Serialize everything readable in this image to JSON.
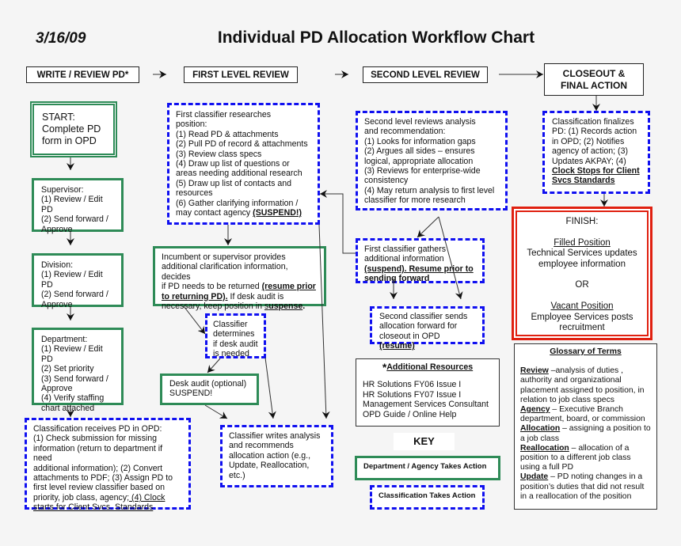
{
  "date": "3/16/09",
  "title": "Individual PD Allocation Workflow Chart",
  "headers": {
    "write": "WRITE / REVIEW PD*",
    "first": "FIRST LEVEL REVIEW",
    "second": "SECOND LEVEL REVIEW",
    "closeout": [
      "CLOSEOUT &",
      "FINAL ACTION"
    ]
  },
  "boxes": {
    "start": {
      "lines": [
        "START:",
        "Complete PD",
        "form in OPD"
      ]
    },
    "supervisor": {
      "lines": [
        "Supervisor:",
        "(1) Review / Edit PD",
        "(2) Send forward /",
        "Approve"
      ]
    },
    "division": {
      "lines": [
        "Division:",
        "(1) Review / Edit PD",
        "(2) Send forward /",
        "Approve"
      ]
    },
    "department": {
      "lines": [
        "Department:",
        "(1) Review / Edit PD",
        "(2) Set priority",
        "(3) Send forward /",
        "Approve",
        "(4) Verify staffing",
        "chart attached"
      ]
    },
    "receives": {
      "lines": [
        "Classification receives PD in OPD:",
        "(1) Check submission for missing",
        "information (return to department if need",
        "additional information); (2) Convert",
        "attachments to PDF; (3) Assign PD to",
        "first level review classifier based on",
        [
          [
            "priority, job class, agency",
            ""
          ],
          [
            "; (4) Clock",
            "u"
          ]
        ],
        [
          [
            "starts for Client Svcs. Standards",
            "u"
          ]
        ]
      ]
    },
    "researches": {
      "lines": [
        "First classifier researches",
        "position:",
        "(1) Read PD & attachments",
        "(2) Pull PD of record & attachments",
        "(3) Review class specs",
        "(4) Draw up list of questions or",
        "areas needing additional research",
        "(5) Draw up list of contacts and",
        "resources",
        "(6) Gather clarifying information /",
        [
          [
            "may contact agency ",
            ""
          ],
          [
            "(SUSPEND!)",
            "bu"
          ]
        ]
      ]
    },
    "incumbent": {
      "lines": [
        "Incumbent or supervisor provides",
        "additional clarification information, decides",
        [
          [
            "if PD needs to be returned ",
            ""
          ],
          [
            "(resume prior",
            "bu"
          ]
        ],
        [
          [
            "to returning PD).",
            "bu"
          ],
          [
            " If desk audit is",
            ""
          ]
        ],
        [
          [
            "necessary, keep position in ",
            ""
          ],
          [
            "s",
            "u"
          ],
          [
            "uspense",
            "bu"
          ],
          [
            ".",
            "b"
          ]
        ]
      ]
    },
    "determines": {
      "lines": [
        "Classifier",
        "determines",
        "if desk audit",
        "is needed"
      ]
    },
    "desk_audit": {
      "lines": [
        "Desk audit (optional)",
        "SUSPEND!"
      ]
    },
    "writes": {
      "lines": [
        "Classifier writes analysis",
        "and recommends",
        "allocation action (e.g.,",
        "Update, Reallocation,",
        "etc.)"
      ]
    },
    "second_reviews": {
      "lines": [
        "Second level reviews analysis",
        "and recommendation:",
        "(1) Looks for information gaps",
        "(2) Argues all sides – ensures",
        "logical, appropriate allocation",
        "(3) Reviews for enterprise-wide",
        "consistency",
        "(4) May return analysis to first level",
        "classifier for more research"
      ]
    },
    "gathers": {
      "lines": [
        "First classifier gathers",
        "additional information",
        [
          [
            "(suspend). Resume prior to",
            "bu"
          ]
        ],
        [
          [
            "sending forward",
            "b"
          ]
        ]
      ]
    },
    "sends": {
      "lines": [
        "Second classifier sends",
        "allocation forward for",
        [
          [
            "closeout in OPD ",
            ""
          ],
          [
            "(resume)",
            "bu"
          ]
        ]
      ]
    },
    "finalizes": {
      "lines": [
        "Classification finalizes",
        "PD: (1) Records action",
        "in OPD; (2) Notifies",
        "agency of action; (3)",
        "Updates AKPAY; (4)",
        [
          [
            "Clock Stops for Client",
            "bu"
          ]
        ],
        [
          [
            "Svcs Standards",
            "bu"
          ]
        ]
      ]
    },
    "finish": {
      "lines": [
        "FINISH:",
        "",
        [
          [
            "Filled Position",
            "u"
          ]
        ],
        "Technical Services updates",
        "employee information",
        "",
        "OR",
        "",
        [
          [
            "Vacant Position",
            "u"
          ]
        ],
        "Employee Services posts",
        "recruitment"
      ]
    }
  },
  "resources": {
    "star": "*",
    "title": "Additional Resources",
    "items": [
      "HR Solutions FY06 Issue I",
      "HR Solutions FY07 Issue I",
      "Management Services Consultant",
      "OPD Guide / Online Help"
    ]
  },
  "key": {
    "title": "KEY",
    "department": "Department / Agency Takes Action",
    "classification": "Classification Takes Action"
  },
  "glossary": {
    "title": "Glossary of Terms",
    "terms": [
      {
        "term": "Review",
        "def": " –analysis of duties , authority and organizational placement assigned to position, in relation to job class specs"
      },
      {
        "term": "Agency",
        "def": " – Executive Branch department, board, or commission"
      },
      {
        "term": "Allocation",
        "def": " – assigning a position to a job class"
      },
      {
        "term": "Reallocation",
        "def": " – allocation of a position to a different job class using a full PD"
      },
      {
        "term": "Update",
        "def": " – PD noting changes in a position’s duties that did not result in a reallocation of the position"
      }
    ]
  },
  "colors": {
    "department": "#2e8b57",
    "classification": "#1010f0",
    "finish": "#e02010"
  }
}
